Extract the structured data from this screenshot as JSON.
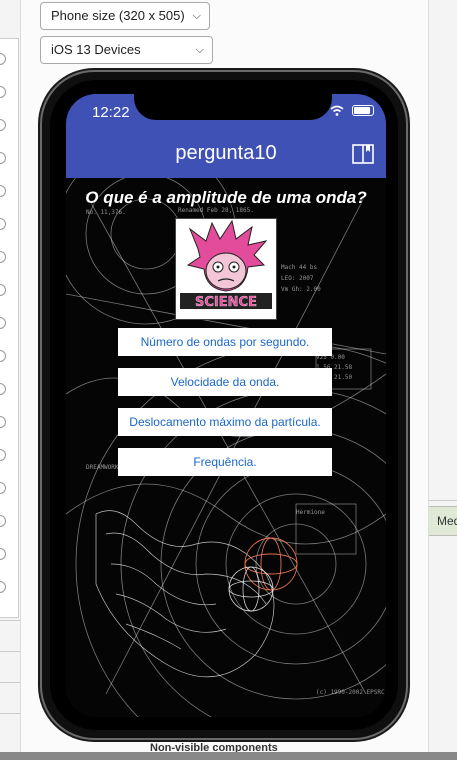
{
  "device_select": {
    "value": "Phone size (320 x 505)"
  },
  "theme_select": {
    "value": "iOS 13 Devices"
  },
  "status": {
    "time": "12:22"
  },
  "app": {
    "title": "pergunta10",
    "question": "O que é a amplitude de uma onda?",
    "image_text": "SCIENCE",
    "answers": [
      "Número de ondas por segundo.",
      "Velocidade da onda.",
      "Deslocamento máximo da partícula.",
      "Frequência."
    ]
  },
  "right_panel": {
    "tab_label": "Med"
  },
  "bottom_hint": "Non-visible components",
  "colors": {
    "appbar": "#3f51b5",
    "answer_text": "#1a67c9"
  },
  "icons": [
    "book-icon",
    "wifi-icon",
    "battery-icon",
    "chevron-down-icon"
  ]
}
